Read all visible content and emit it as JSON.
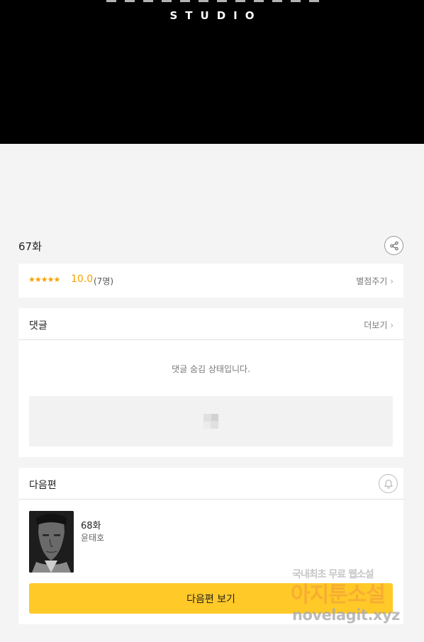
{
  "hero": {
    "logo_text": "STUDIO"
  },
  "episode": {
    "title": "67화"
  },
  "rating": {
    "stars": "★★★★★",
    "score": "10.0",
    "count": "(7명)",
    "rate_link": "별점주기"
  },
  "comments": {
    "label": "댓글",
    "more_link": "더보기",
    "hidden_message": "댓글 숨김 상태입니다."
  },
  "next": {
    "label": "다음편",
    "title": "68화",
    "author": "윤태호",
    "button_label": "다음편 보기"
  },
  "watermark": {
    "line1": "국내최초 무료 웹소설",
    "line2": "아지툰소설",
    "line3": "novelagit.xyz"
  },
  "colors": {
    "accent": "#ffc928",
    "rating": "#f5a300",
    "hero_bg": "#000000"
  },
  "icons": {
    "share": "share-icon",
    "chevron": "chevron-right-icon",
    "bell": "bell-icon",
    "ad": "ad-placeholder-icon"
  }
}
